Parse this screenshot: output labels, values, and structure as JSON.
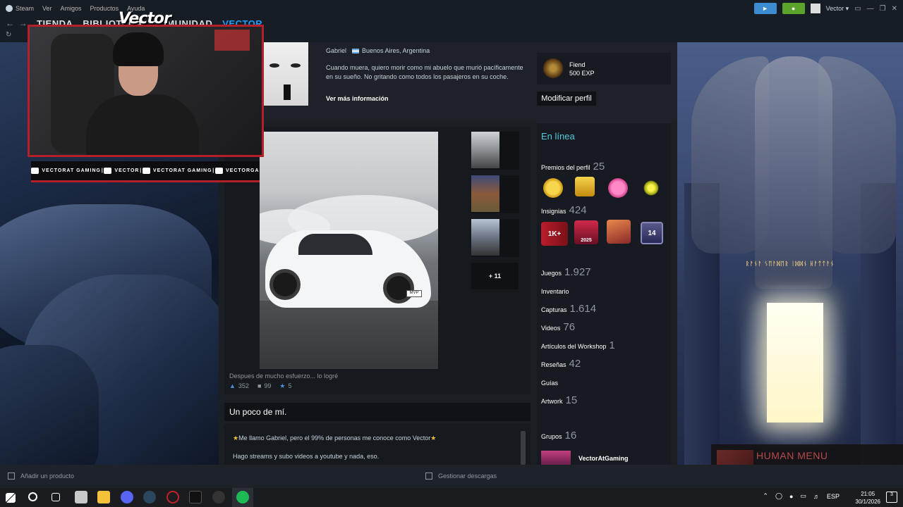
{
  "menubar": {
    "app_name": "Steam",
    "items": [
      "Ver",
      "Amigos",
      "Productos",
      "Ayuda"
    ],
    "username": "Vector"
  },
  "nav": {
    "tabs": [
      "TIENDA",
      "BIBLIOTECA",
      "COMUNIDAD",
      "VECTOR"
    ],
    "active_tab": "VECTOR"
  },
  "overlay": {
    "logo_text": "Vector",
    "socials": [
      {
        "icon": "youtube-icon",
        "label": "VECTORAT GAMING"
      },
      {
        "icon": "twitch-icon",
        "label": "VECTOR"
      },
      {
        "icon": "twitter-icon",
        "label": "VECTORAT GAMING"
      },
      {
        "icon": "instagram-icon",
        "label": "VECTORGA"
      }
    ]
  },
  "profile": {
    "real_name": "Gabriel",
    "location": "Buenos Aires, Argentina",
    "summary": "Cuando muera, quiero morir como mi abuelo que murió pacíficamente en su sueño. No gritando como todos los pasajeros en su coche.",
    "more_info": "Ver más información",
    "level_name": "Fiend",
    "level_exp": "500 EXP",
    "edit_button": "Modificar perfil",
    "status": "En línea"
  },
  "showcase": {
    "caption": "Despues de mucho esfuerzo... lo logré",
    "likes": "352",
    "comments": "99",
    "awards": "5",
    "more": "+ 11",
    "plate": "MVP"
  },
  "about": {
    "title": "Un poco de mí.",
    "line1": "Me llamo Gabriel, pero el 99% de personas me conoce como Vector",
    "line2": "Hago streams y subo videos a youtube y nada, eso."
  },
  "sidebar": {
    "profile_awards_label": "Premios del perfil",
    "profile_awards_count": "25",
    "badges_label": "Insignias",
    "badges_count": "424",
    "badge_texts": [
      "1K+",
      "2025",
      "",
      "14"
    ],
    "games_label": "Juegos",
    "games_count": "1.927",
    "inventory_label": "Inventario",
    "screenshots_label": "Capturas",
    "screenshots_count": "1.614",
    "videos_label": "Videos",
    "videos_count": "76",
    "workshop_label": "Artículos del Workshop",
    "workshop_count": "1",
    "reviews_label": "Reseñas",
    "reviews_count": "42",
    "guides_label": "Guías",
    "artwork_label": "Artwork",
    "artwork_count": "15",
    "groups_label": "Grupos",
    "groups_count": "16",
    "group_name": "VectorAtGaming"
  },
  "background": {
    "runes": "ᚱᚨᚾᚨ ᛊᛖᚨᛞᛖᚱ ᛁᛞᛞᚾ ᚺᚨᛏᛏᚨᚾ"
  },
  "human_menu": {
    "title": "HUMAN MENU"
  },
  "bottom_bar": {
    "add_product": "Añadir un producto",
    "downloads": "Gestionar descargas"
  },
  "taskbar": {
    "lang": "ESP",
    "time": "21:05",
    "date": "30/1/2026",
    "notifications": "3"
  },
  "colors": {
    "accent_blue": "#1a9fff",
    "online_cyan": "#57cbde",
    "overlay_red": "#b3202a",
    "notif_green": "#5ba32b"
  }
}
